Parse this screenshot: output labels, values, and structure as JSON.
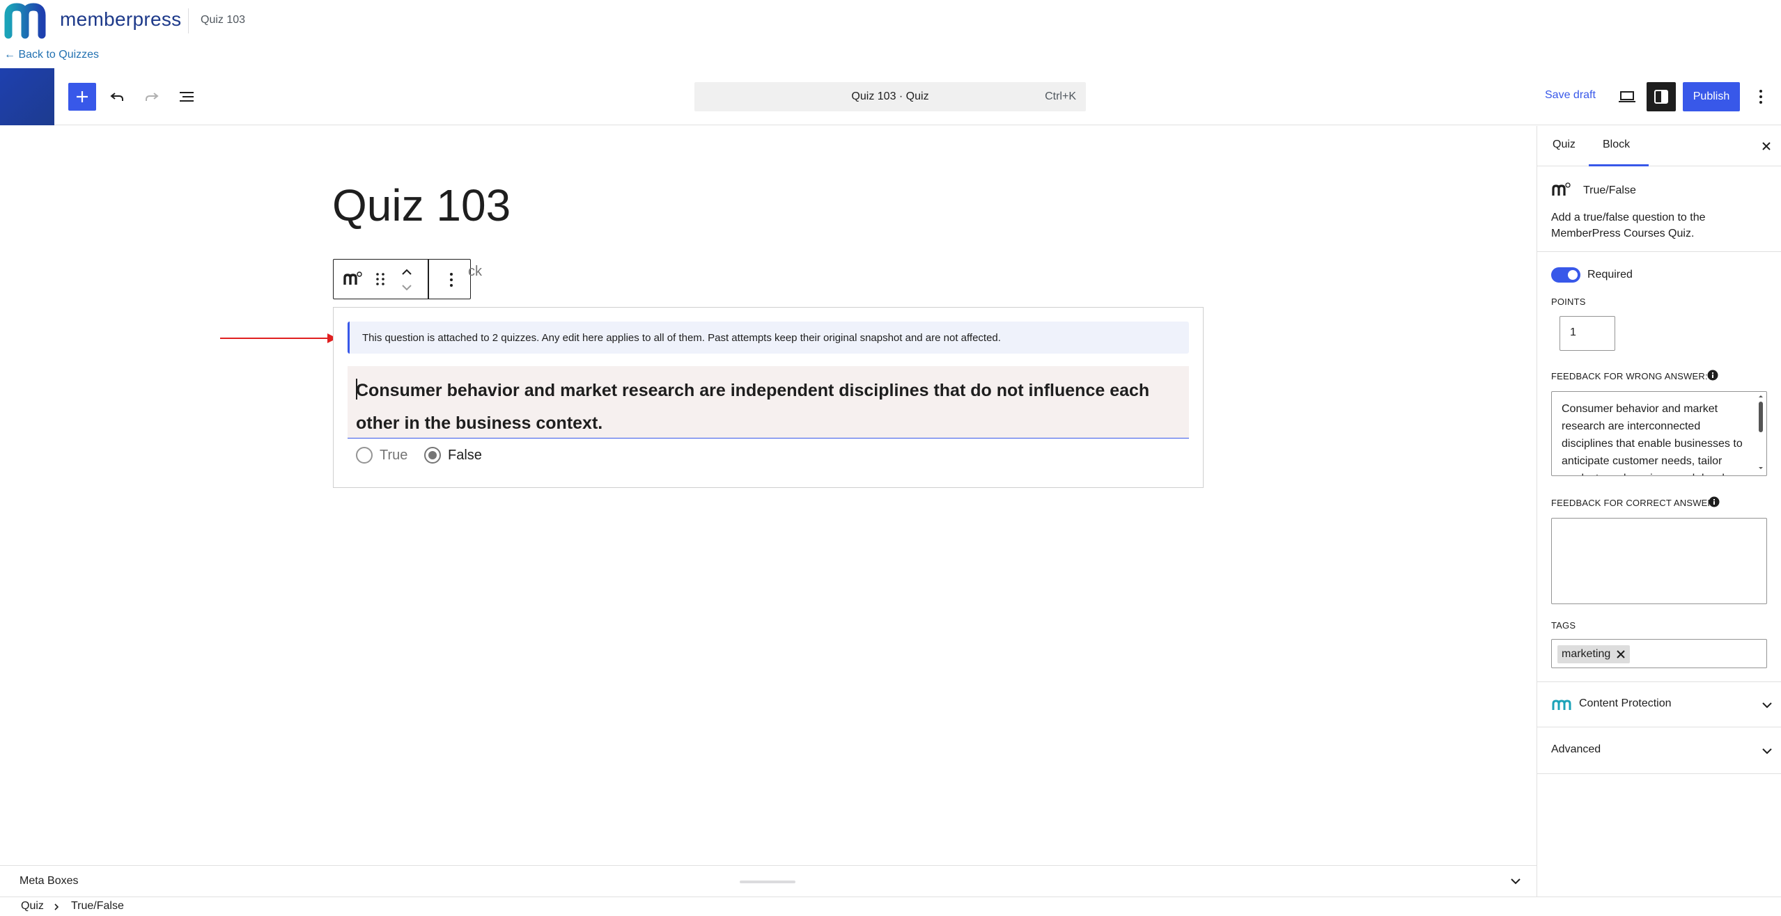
{
  "brand": {
    "logo_text": "memberpress",
    "page_name": "Quiz 103",
    "back_link": "← Back to Quizzes"
  },
  "toolbar": {
    "add_icon": "plus-icon",
    "undo_icon": "undo-icon",
    "redo_icon": "redo-icon",
    "outline_icon": "list-view-icon",
    "command_title": "Quiz 103 · Quiz",
    "command_shortcut": "Ctrl+K",
    "save_draft": "Save draft",
    "preview_icon": "laptop-icon",
    "settings_icon": "sidebar-toggle-icon",
    "publish": "Publish",
    "options_icon": "kebab-menu-icon"
  },
  "canvas": {
    "title": "Quiz 103",
    "ghost_text": "ck",
    "notice": "This question is attached to 2 quizzes. Any edit here applies to all of them. Past attempts keep their original snapshot and are not affected.",
    "question": "Consumer behavior and market research are independent disciplines that do not influence each other in the business context.",
    "options": [
      {
        "label": "True",
        "selected": false
      },
      {
        "label": "False",
        "selected": true
      }
    ]
  },
  "meta_boxes": {
    "label": "Meta Boxes"
  },
  "breadcrumb": [
    "Quiz",
    "True/False"
  ],
  "sidebar": {
    "tabs": [
      "Quiz",
      "Block"
    ],
    "active_tab": "Block",
    "block_name": "True/False",
    "block_description": "Add a true/false question to the MemberPress Courses Quiz.",
    "required_label": "Required",
    "required_on": true,
    "points_label": "POINTS",
    "points_value": "1",
    "feedback_wrong_label": "FEEDBACK FOR WRONG ANSWER:",
    "feedback_wrong_text": "Consumer behavior and market research are interconnected disciplines that enable businesses to anticipate customer needs, tailor products and services, and develop",
    "feedback_correct_label": "FEEDBACK FOR CORRECT ANSWER:",
    "feedback_correct_text": "",
    "tags_label": "TAGS",
    "tags": [
      "marketing"
    ],
    "panels": [
      "Content Protection",
      "Advanced"
    ]
  },
  "colors": {
    "accent": "#3858e9",
    "brand_blue": "#1e40af",
    "brand_teal": "#1ba3b8",
    "notice_bg": "#eff2fb",
    "question_bg": "#f6f0ef",
    "arrow": "#e02020"
  }
}
